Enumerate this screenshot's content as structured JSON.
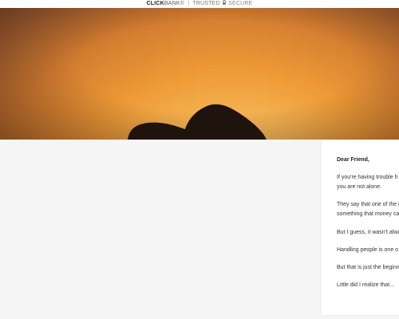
{
  "topbar": {
    "brand_strong": "CLICK",
    "brand_light": "BANK",
    "reg": "®",
    "separator": "|",
    "trusted": "TRUSTED",
    "secure": "SECURE"
  },
  "letter": {
    "greeting": "Dear Friend,",
    "paragraphs": [
      "If you're having trouble h",
      "you are not alone.",
      "They say that one of the g",
      "something that money ca",
      "But I guess, it wasn't alwa",
      "Handling people is one o",
      "But that is just the beginn",
      "Little did I realize that..."
    ]
  },
  "colors": {
    "sky_warm": "#ee9a36",
    "sun": "#fbe0a0",
    "silhouette": "#1e130f"
  }
}
